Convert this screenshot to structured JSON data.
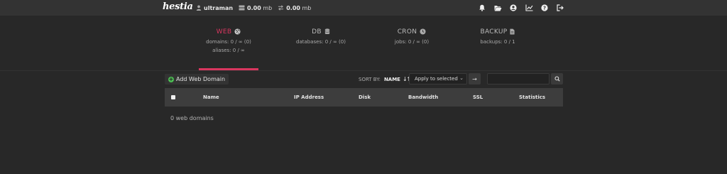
{
  "topbar": {
    "logo": "hestia",
    "username": "ultraman",
    "disk_usage": "0.00",
    "disk_unit": "mb",
    "bandwidth_usage": "0.00",
    "bandwidth_unit": "mb",
    "icons": [
      "bell-icon",
      "folder-open-icon",
      "user-circle-icon",
      "chart-line-icon",
      "help-icon",
      "logout-icon"
    ]
  },
  "tabs": [
    {
      "title": "WEB",
      "icon": "globe-icon",
      "lines": [
        "domains: 0 / ∞ (0)",
        "aliases: 0 / ∞"
      ],
      "active": true
    },
    {
      "title": "DB",
      "icon": "database-icon",
      "lines": [
        "databases: 0 / ∞ (0)"
      ],
      "active": false
    },
    {
      "title": "CRON",
      "icon": "clock-icon",
      "lines": [
        "jobs: 0 / ∞ (0)"
      ],
      "active": false
    },
    {
      "title": "BACKUP",
      "icon": "file-icon",
      "lines": [
        "backups: 0 / 1"
      ],
      "active": false
    }
  ],
  "toolbar": {
    "add_label": "Add Web Domain",
    "sort_by_label": "SORT BY:",
    "sort_by_value": "NAME",
    "sort_arrow": "↓⇅",
    "apply_select_value": "Apply to selected",
    "apply_go": "→",
    "search_placeholder": ""
  },
  "table": {
    "columns": [
      "Name",
      "IP Address",
      "Disk",
      "Bandwidth",
      "SSL",
      "Statistics"
    ]
  },
  "empty_note": "0 web domains",
  "colors": {
    "accent": "#d9365f",
    "add_icon": "#4cbd53",
    "background": "#282828",
    "topbar": "#333333"
  }
}
